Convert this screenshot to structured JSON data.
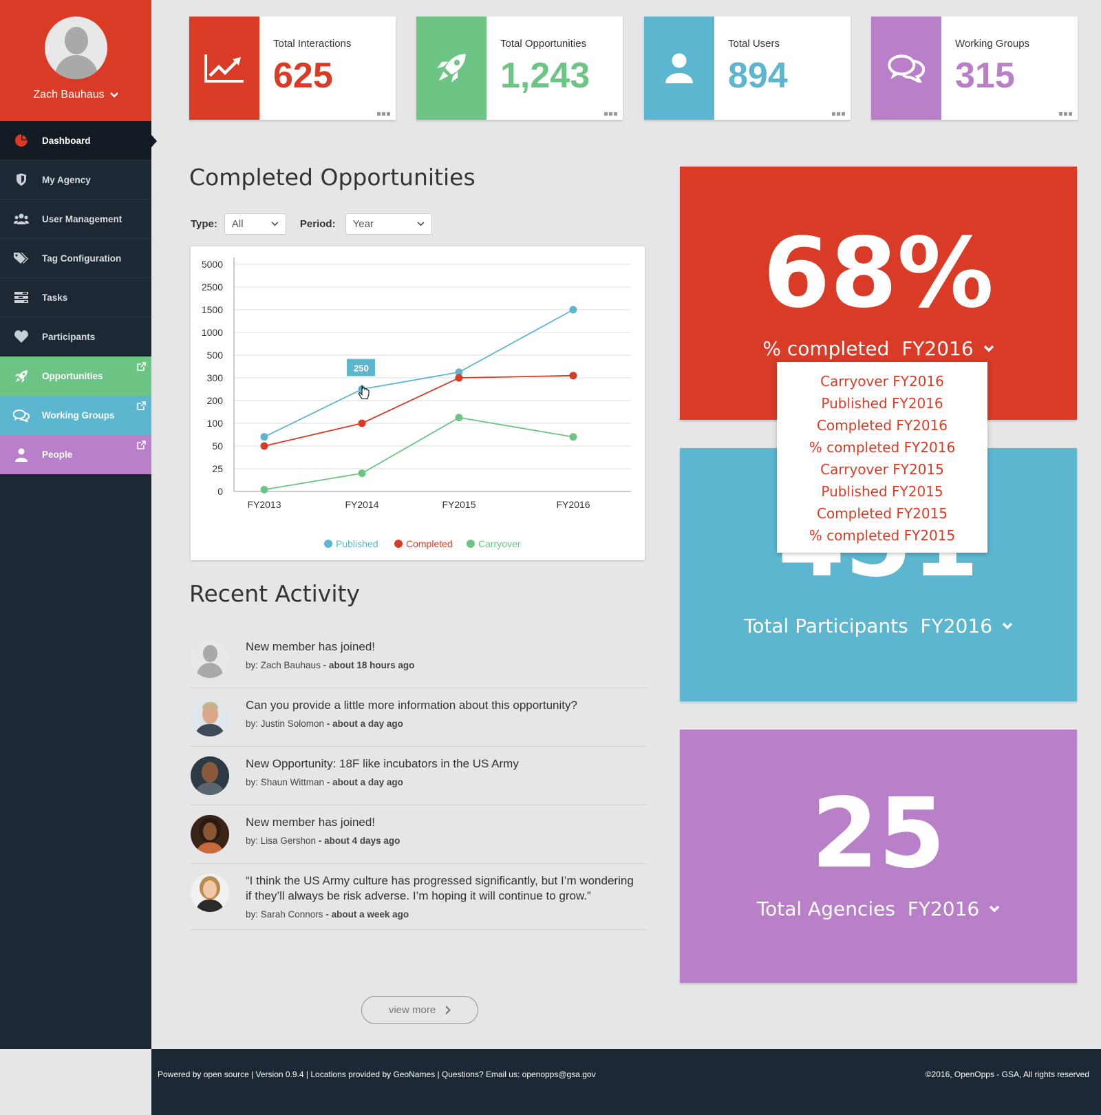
{
  "user": {
    "name": "Zach Bauhaus"
  },
  "sidebar": {
    "items": [
      {
        "label": "Dashboard",
        "icon": "pie-chart-icon"
      },
      {
        "label": "My Agency",
        "icon": "shield-icon"
      },
      {
        "label": "User Management",
        "icon": "users-icon"
      },
      {
        "label": "Tag Configuration",
        "icon": "tags-icon"
      },
      {
        "label": "Tasks",
        "icon": "tasks-icon"
      },
      {
        "label": "Participants",
        "icon": "heart-icon"
      },
      {
        "label": "Opportunities",
        "icon": "rocket-icon"
      },
      {
        "label": "Working Groups",
        "icon": "chat-icon"
      },
      {
        "label": "People",
        "icon": "person-icon"
      }
    ]
  },
  "stats": [
    {
      "label": "Total Interactions",
      "value": "625",
      "color": "#d93b27",
      "icon": "trend-chart-icon"
    },
    {
      "label": "Total Opportunities",
      "value": "1,243",
      "color": "#6cc485",
      "icon": "rocket-icon"
    },
    {
      "label": "Total Users",
      "value": "894",
      "color": "#5cb6d0",
      "icon": "user-icon"
    },
    {
      "label": "Working Groups",
      "value": "315",
      "color": "#b97fc8",
      "icon": "chat-bubbles-icon"
    }
  ],
  "completed": {
    "title": "Completed Opportunities",
    "type_label": "Type:",
    "type_value": "All",
    "period_label": "Period:",
    "period_value": "Year",
    "tooltip": "250"
  },
  "chart_data": {
    "type": "line",
    "categories": [
      "FY2013",
      "FY2014",
      "FY2015",
      "FY2016"
    ],
    "y_ticks": [
      "5000",
      "2500",
      "1500",
      "1000",
      "500",
      "300",
      "200",
      "100",
      "50",
      "25",
      "0"
    ],
    "series": [
      {
        "name": "Published",
        "color": "#5cb6d0",
        "values": [
          70,
          250,
          350,
          1500
        ]
      },
      {
        "name": "Completed",
        "color": "#d93b27",
        "values": [
          50,
          100,
          300,
          320
        ]
      },
      {
        "name": "Carryover",
        "color": "#6cc485",
        "values": [
          2,
          20,
          125,
          70
        ]
      }
    ],
    "grid": true,
    "legend": "bottom"
  },
  "activity": {
    "title": "Recent Activity",
    "items": [
      {
        "text": "New member has joined!",
        "by": "by: Zach Bauhaus",
        "time": "- about 18 hours ago"
      },
      {
        "text": "Can you provide a little more information about this opportunity?",
        "by": "by: Justin Solomon",
        "time": "- about a day ago"
      },
      {
        "text": "New Opportunity: 18F like incubators in the US Army",
        "by": "by: Shaun Wittman",
        "time": "- about a day ago"
      },
      {
        "text": "New member has joined!",
        "by": "by: Lisa Gershon",
        "time": "- about 4 days ago"
      },
      {
        "text": "“I think the US Army culture has progressed significantly, but I’m wondering if they’ll always be risk adverse. I’m hoping it will continue to grow.”",
        "by": "by: Sarah Connors",
        "time": "- about a week ago"
      }
    ],
    "view_more": "view more"
  },
  "panels": {
    "completed_pct": {
      "value": "68%",
      "caption": "% completed  FY2016",
      "color": "#d93b27"
    },
    "participants": {
      "value": "451",
      "caption": "Total Participants  FY2016",
      "color": "#5cb6d0"
    },
    "agencies": {
      "value": "25",
      "caption": "Total Agencies  FY2016",
      "color": "#b97fc8"
    }
  },
  "dropdown_options": [
    "Carryover FY2016",
    "Published FY2016",
    "Completed FY2016",
    "% completed FY2016",
    "Carryover FY2015",
    "Published FY2015",
    "Completed FY2015",
    "% completed FY2015"
  ],
  "footer": {
    "left": "Powered by open source | Version 0.9.4 | Locations provided by GeoNames | Questions? Email us: openopps@gsa.gov",
    "right": "©2016, OpenOpps - GSA, All rights reserved"
  }
}
